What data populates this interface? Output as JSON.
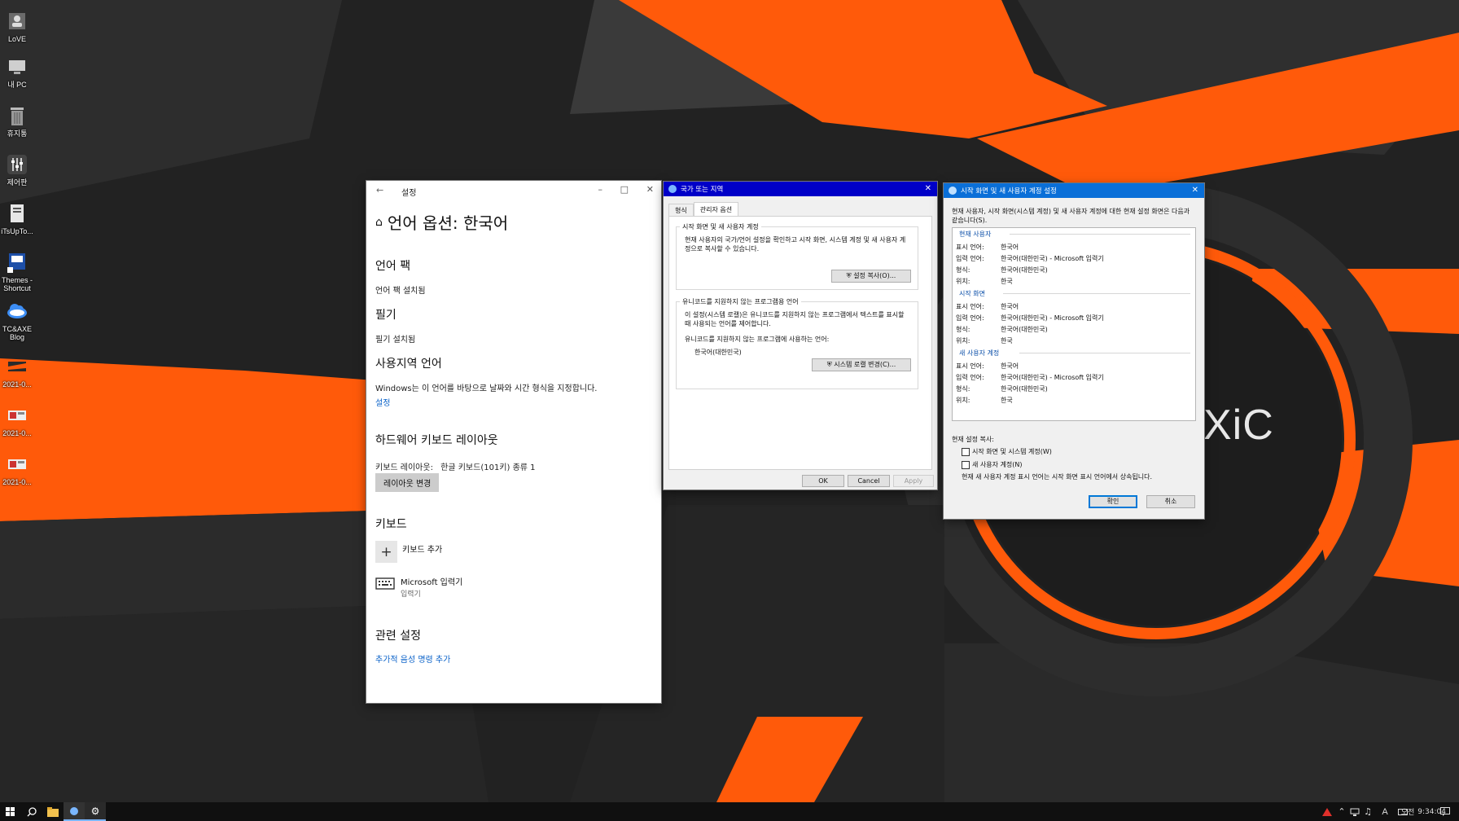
{
  "desktop": {
    "brand_text": "XiC",
    "icons": [
      {
        "label": "LoVE",
        "icon": "user-icon"
      },
      {
        "label": "내 PC",
        "icon": "computer-icon"
      },
      {
        "label": "휴지통",
        "icon": "recycle-bin-icon"
      },
      {
        "label": "제어판",
        "icon": "control-panel-icon"
      },
      {
        "label": "iTsUpTo...",
        "icon": "app-icon"
      },
      {
        "label": "Themes -\nShortcut",
        "icon": "themes-icon"
      },
      {
        "label": "TC&AXE\nBlog",
        "icon": "cloud-icon"
      },
      {
        "label": "2021-0...",
        "icon": "image-file-icon"
      },
      {
        "label": "2021-0...",
        "icon": "image-file-icon"
      },
      {
        "label": "2021-0...",
        "icon": "image-file-icon"
      }
    ]
  },
  "settings": {
    "window_title": "설정",
    "page_title": "언어 옵션: 한국어",
    "language_pack": {
      "heading": "언어 팩",
      "status": "언어 팩 설치됨"
    },
    "handwriting": {
      "heading": "필기",
      "status": "필기 설치됨"
    },
    "regional": {
      "heading": "사용지역 언어",
      "description": "Windows는 이 언어를 바탕으로 날짜와 시간 형식을 지정합니다.",
      "link": "설정"
    },
    "hw_keyboard": {
      "heading": "하드웨어 키보드 레이아웃",
      "layout_label": "키보드 레이아웃:",
      "layout_value": "한글 키보드(101키) 종류 1",
      "change_button": "레이아웃 변경"
    },
    "keyboards": {
      "heading": "키보드",
      "add_label": "키보드 추가",
      "item_name": "Microsoft 입력기",
      "item_sub": "입력기"
    },
    "related": {
      "heading": "관련 설정",
      "link": "추가적 음성 명령 추가"
    }
  },
  "region_dialog": {
    "title": "국가 또는 지역",
    "tabs": [
      "형식",
      "관리자 옵션"
    ],
    "active_tab": "관리자 옵션",
    "welcome": {
      "heading": "시작 화면 및 새 사용자 계정",
      "text": "현재 사용자의 국가/언어 설정을 확인하고 시작 화면, 시스템 계정 및 새 사용자 계정으로 복사할 수 있습니다.",
      "button": "설정 복사(O)..."
    },
    "unicode": {
      "heading": "유니코드를 지원하지 않는 프로그램용 언어",
      "text": "이 설정(시스템 로캘)은 유니코드를 지원하지 않는 프로그램에서 텍스트를 표시할 때 사용되는 언어를 제어합니다.",
      "current_label": "유니코드를 지원하지 않는 프로그램에 사용하는 언어:",
      "current_value": "한국어(대한민국)",
      "button": "시스템 로캘 변경(C)..."
    },
    "ok": "OK",
    "cancel": "Cancel",
    "apply": "Apply"
  },
  "copy_dialog": {
    "title": "시작 화면 및 새 사용자 계정 설정",
    "intro": "현재 사용자, 시작 화면(시스템 계정) 및 새 사용자 계정에 대한 현재 설정 화면은 다음과 같습니다(S).",
    "sections": [
      {
        "heading": "현재 사용자",
        "rows": [
          [
            "표시 언어:",
            "한국어"
          ],
          [
            "입력 언어:",
            "한국어(대한민국) - Microsoft 입력기"
          ],
          [
            "형식:",
            "한국어(대한민국)"
          ],
          [
            "위치:",
            "한국"
          ]
        ]
      },
      {
        "heading": "시작 화면",
        "rows": [
          [
            "표시 언어:",
            "한국어"
          ],
          [
            "입력 언어:",
            "한국어(대한민국) - Microsoft 입력기"
          ],
          [
            "형식:",
            "한국어(대한민국)"
          ],
          [
            "위치:",
            "한국"
          ]
        ]
      },
      {
        "heading": "새 사용자 계정",
        "rows": [
          [
            "표시 언어:",
            "한국어"
          ],
          [
            "입력 언어:",
            "한국어(대한민국) - Microsoft 입력기"
          ],
          [
            "형식:",
            "한국어(대한민국)"
          ],
          [
            "위치:",
            "한국"
          ]
        ]
      }
    ],
    "copy_label": "현재 설정 복사:",
    "checkbox1": "시작 화면 및 시스템 계정(W)",
    "checkbox2": "새 사용자 계정(N)",
    "note": "현재 새 사용자 계정 표시 언어는 시작 화면 표시 언어에서 상속됩니다.",
    "ok": "확인",
    "cancel": "취소"
  },
  "taskbar": {
    "ime": "A",
    "ampm": "오전",
    "time": "9:34:04"
  },
  "colors": {
    "accent": "#0078d7",
    "orange": "#ff5a0a",
    "link": "#0a62c9",
    "title_blue": "#0000c8"
  }
}
